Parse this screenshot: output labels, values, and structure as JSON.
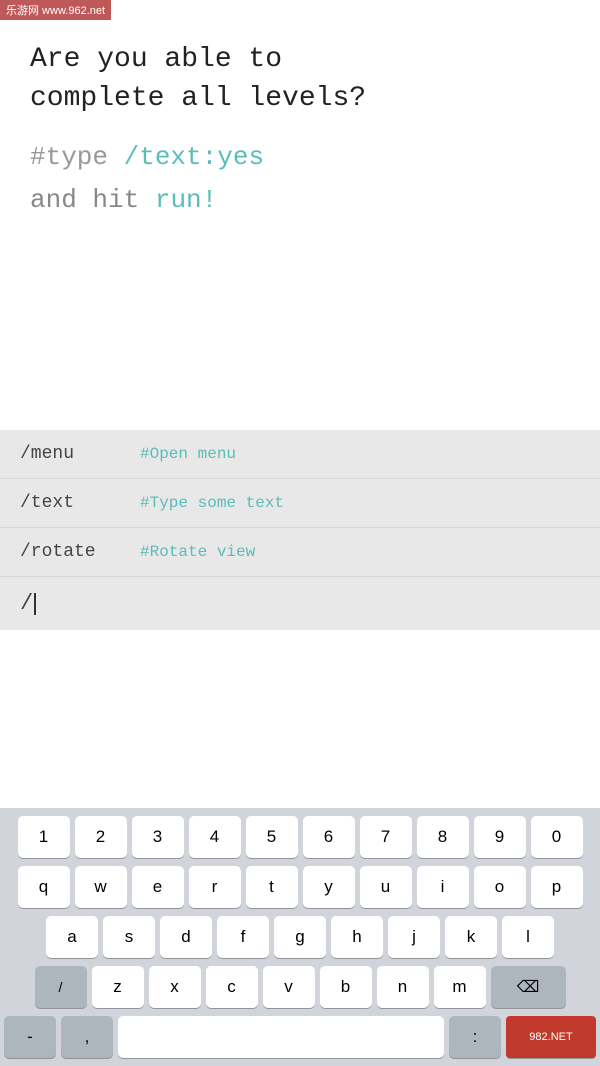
{
  "watermark": {
    "top": "乐游网 www.962.net"
  },
  "main": {
    "headline_line1": "Are you able to",
    "headline_line2": "complete all levels?",
    "code_line1_hash": "#type",
    "code_line1_slash": "/text",
    "code_line1_colon": ":",
    "code_line1_value": "yes",
    "code_line2_and": "and",
    "code_line2_hit": "hit",
    "code_line2_run": "run!"
  },
  "commands": [
    {
      "name": "/menu",
      "desc": "#Open menu"
    },
    {
      "name": "/text",
      "desc": "#Type some text"
    },
    {
      "name": "/rotate",
      "desc": "#Rotate view"
    }
  ],
  "input": {
    "value": "/"
  },
  "keyboard": {
    "row1": [
      "1",
      "2",
      "3",
      "4",
      "5",
      "6",
      "7",
      "8",
      "9",
      "0"
    ],
    "row2": [
      "q",
      "w",
      "e",
      "r",
      "t",
      "y",
      "u",
      "i",
      "o",
      "p"
    ],
    "row3": [
      "a",
      "s",
      "d",
      "f",
      "g",
      "h",
      "j",
      "k",
      "l"
    ],
    "row4": [
      "/",
      "z",
      "x",
      "c",
      "v",
      "b",
      "n",
      "m"
    ],
    "row5_left": [
      "-",
      ","
    ],
    "row5_right": [
      ":"
    ],
    "backspace_label": "⌫",
    "shift_label": "⇧",
    "space_label": ""
  }
}
